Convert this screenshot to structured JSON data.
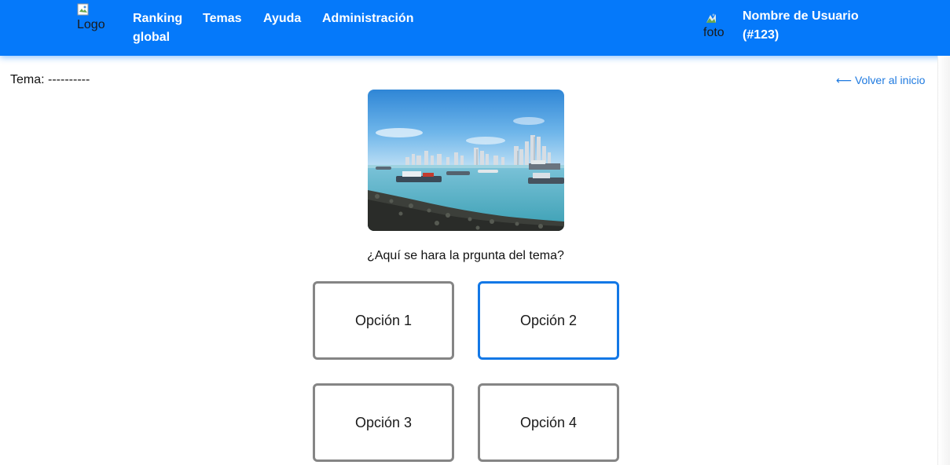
{
  "header": {
    "logo_alt": "Logo",
    "nav": [
      {
        "label": "Ranking global"
      },
      {
        "label": "Temas"
      },
      {
        "label": "Ayuda"
      },
      {
        "label": "Administración"
      }
    ],
    "avatar_alt": "foto",
    "user": {
      "name": "Nombre de Usuario",
      "id": "(#123)"
    }
  },
  "main": {
    "topic_label": "Tema: ----------",
    "back_link": "⟵ Volver al inicio",
    "question": "¿Aquí se hara la prgunta del tema?",
    "options": [
      {
        "label": "Opción 1",
        "selected": false
      },
      {
        "label": "Opción 2",
        "selected": true
      },
      {
        "label": "Opción 3",
        "selected": false
      },
      {
        "label": "Opción 4",
        "selected": false
      }
    ]
  },
  "colors": {
    "navbar": "#0579fa",
    "link": "#1f7ae0",
    "selected_border": "#1378e6",
    "option_border": "#858585"
  }
}
